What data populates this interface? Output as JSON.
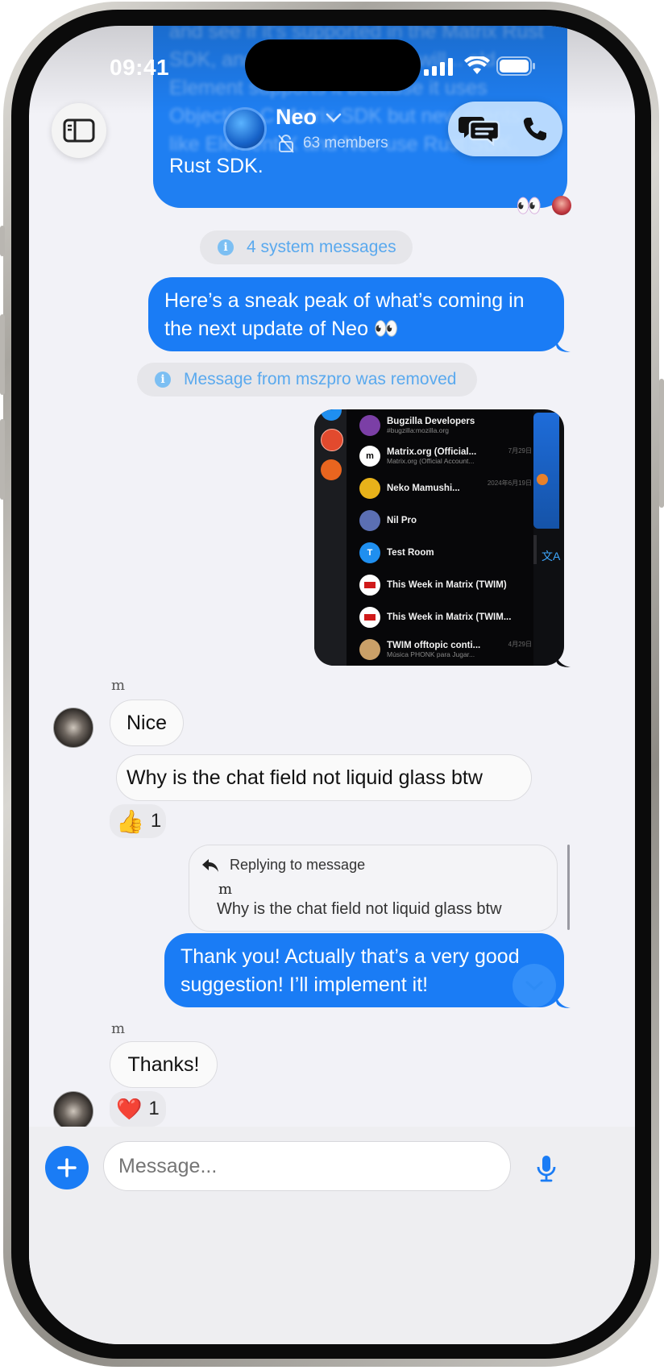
{
  "status_bar": {
    "time": "09:41"
  },
  "header": {
    "title": "Neo",
    "subtitle": "63 members",
    "blurred_text": "and see if it's supported in the Matrix Rust SDK, and if it's supported, I will... old Element supports it because it uses Objective-C Matrix SDK but new clients like Element X and Neo use Rust SDK.",
    "blurred_last_line": "Rust SDK."
  },
  "read_receipts": {
    "emoji": "👀"
  },
  "system_messages": {
    "collapsed_label": "4 system messages",
    "removed_label": "Message from mszpro was removed"
  },
  "messages": {
    "sneak_peek": "Here’s a sneak peak of what’s coming in the next update of Neo 👀",
    "sender_initial": "m",
    "nice": "Nice",
    "why_glass": "Why is the chat field not liquid glass btw",
    "thumbs_emoji": "👍",
    "thumbs_count": "1",
    "reply_header": "Replying to message",
    "reply_sender": "m",
    "reply_quote": "Why is the chat field not liquid glass btw",
    "thank_you": "Thank you! Actually that’s a very good suggestion! I’ll implement it!",
    "thanks": "Thanks!",
    "heart_emoji": "❤️",
    "heart_count": "1"
  },
  "screenshot_rooms": [
    {
      "name": "Bugzilla Developers",
      "sub": "#bugzilla:mozilla.org",
      "date": "",
      "color": "#7b3fa6"
    },
    {
      "name": "Matrix.org (Official...",
      "sub": "Matrix.org (Official Account...",
      "date": "7月29日",
      "color": "#ffffff"
    },
    {
      "name": "Neko Mamushi...",
      "sub": "",
      "date": "2024年6月19日",
      "color": "#e8b21a"
    },
    {
      "name": "Nil Pro",
      "sub": "",
      "date": "",
      "color": "#5b6fb3"
    },
    {
      "name": "Test Room",
      "sub": "",
      "date": "",
      "color": "#1f8ff0"
    },
    {
      "name": "This Week in Matrix (TWIM)",
      "sub": "",
      "date": "",
      "color": "#ffffff"
    },
    {
      "name": "This Week in Matrix (TWIM...",
      "sub": "",
      "date": "",
      "color": "#ffffff"
    },
    {
      "name": "TWIM offtopic conti...",
      "sub": "Música PHONK para Jugar...",
      "date": "4月29日",
      "color": "#caa068"
    }
  ],
  "composer": {
    "placeholder": "Message..."
  },
  "colors": {
    "accent": "#1a7cf5",
    "background": "#f2f2f7",
    "system_text": "#5aa9ee"
  }
}
